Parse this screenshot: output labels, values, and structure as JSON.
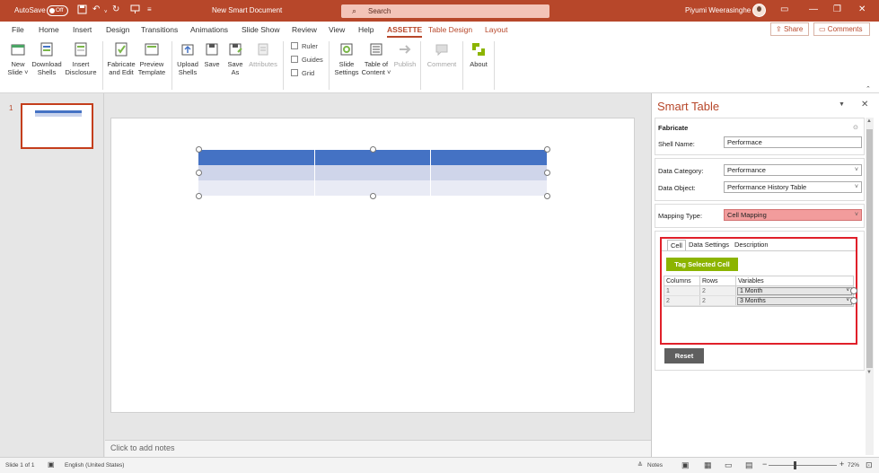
{
  "titlebar": {
    "autosave_label": "AutoSave",
    "autosave_state": "Off",
    "doc_title": "New Smart Document",
    "search_placeholder": "Search",
    "user_name": "Piyumi Weerasinghe",
    "window_controls": [
      "minimize-icon",
      "restore-icon",
      "close-icon"
    ]
  },
  "menu": {
    "tabs": [
      "File",
      "Home",
      "Insert",
      "Design",
      "Transitions",
      "Animations",
      "Slide Show",
      "Review",
      "View",
      "Help",
      "ASSETTE",
      "Table Design",
      "Layout"
    ],
    "active_tab": "ASSETTE",
    "share": "Share",
    "comments": "Comments"
  },
  "ribbon": {
    "new_slide": [
      "New",
      "Slide ˅"
    ],
    "download_shells": [
      "Download",
      "Shells"
    ],
    "insert_disclosure": [
      "Insert",
      "Disclosure"
    ],
    "fabricate_edit": [
      "Fabricate",
      "and Edit"
    ],
    "preview_template": [
      "Preview",
      "Template"
    ],
    "upload_shells": [
      "Upload",
      "Shells"
    ],
    "save": "Save",
    "save_as": [
      "Save",
      "As"
    ],
    "attributes": "Attributes",
    "ruler": "Ruler",
    "guides": "Guides",
    "grid": "Grid",
    "slide_settings": [
      "Slide",
      "Settings"
    ],
    "table_of_content": [
      "Table of",
      "Content ˅"
    ],
    "publish": "Publish",
    "comment": "Comment",
    "about": "About"
  },
  "slides": {
    "current_number": "1"
  },
  "notes_placeholder": "Click to add notes",
  "pane": {
    "title": "Smart Table",
    "fabricate_heading": "Fabricate",
    "shell_name_label": "Shell Name:",
    "shell_name_value": "Performace",
    "data_category_label": "Data Category:",
    "data_category_value": "Performance",
    "data_object_label": "Data Object:",
    "data_object_value": "Performance History Table",
    "mapping_type_label": "Mapping Type:",
    "mapping_type_value": "Cell Mapping",
    "tabs": [
      "Cell",
      "Data Settings",
      "Description"
    ],
    "active_tab": "Cell",
    "tag_button": "Tag Selected Cell",
    "grid_headers": [
      "Columns",
      "Rows",
      "Variables"
    ],
    "grid_rows": [
      {
        "column": "1",
        "row": "2",
        "variable": "1 Month"
      },
      {
        "column": "2",
        "row": "2",
        "variable": "3 Months"
      }
    ],
    "reset_button": "Reset"
  },
  "status": {
    "slide_info": "Slide 1 of 1",
    "language": "English (United States)",
    "notes": "Notes",
    "zoom": "72%"
  },
  "colors": {
    "accent": "#b7472a",
    "table_header": "#4472c4",
    "tag_button": "#8cb400",
    "highlight_box": "#e0202a"
  }
}
